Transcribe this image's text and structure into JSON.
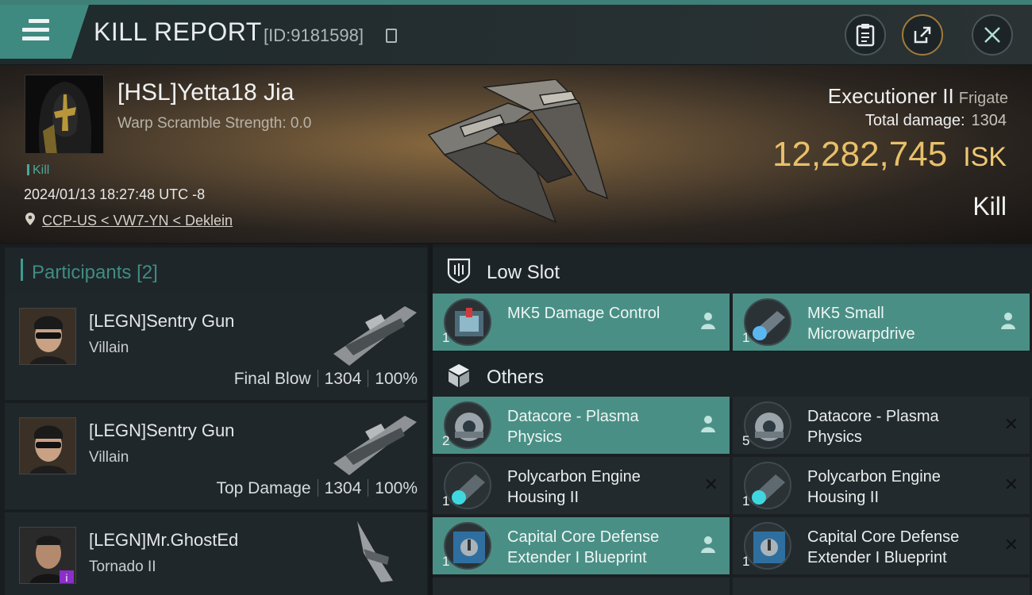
{
  "header": {
    "title": "KILL REPORT",
    "report_id": "[ID:9181598]"
  },
  "victim": {
    "name": "[HSL]Yetta18 Jia",
    "warp_scramble": "Warp Scramble Strength: 0.0",
    "tag": "Kill",
    "datetime": "2024/01/13 18:27:48 UTC -8",
    "location": "CCP-US < VW7-YN < Deklein",
    "ship": "Executioner II",
    "ship_class": "Frigate",
    "total_damage_label": "Total damage:",
    "total_damage": "1304",
    "isk_value": "12,282,745",
    "isk_unit": "ISK",
    "result": "Kill"
  },
  "participants": {
    "title": "Participants",
    "count": "[2]",
    "rows": [
      {
        "name": "[LEGN]Sentry Gun",
        "ship": "Villain",
        "role": "Final Blow",
        "damage": "1304",
        "percent": "100%"
      },
      {
        "name": "[LEGN]Sentry Gun",
        "ship": "Villain",
        "role": "Top Damage",
        "damage": "1304",
        "percent": "100%"
      },
      {
        "name": "[LEGN]Mr.GhostEd",
        "ship": "Tornado II"
      }
    ]
  },
  "sections": {
    "low_slot": "Low Slot",
    "others": "Others"
  },
  "items": [
    {
      "name": "MK5 Damage Control",
      "qty": "1",
      "status": "dropped"
    },
    {
      "name": "MK5 Small Microwarpdrive",
      "qty": "1",
      "status": "dropped"
    },
    {
      "name": "Datacore - Plasma Physics",
      "qty": "2",
      "status": "dropped"
    },
    {
      "name": "Datacore - Plasma Physics",
      "qty": "5",
      "status": "destroyed"
    },
    {
      "name": "Polycarbon Engine Housing II",
      "qty": "1",
      "status": "destroyed"
    },
    {
      "name": "Polycarbon Engine Housing II",
      "qty": "1",
      "status": "destroyed"
    },
    {
      "name": "Capital Core Defense Extender I Blueprint",
      "qty": "1",
      "status": "dropped"
    },
    {
      "name": "Capital Core Defense Extender I Blueprint",
      "qty": "1",
      "status": "destroyed"
    }
  ],
  "colors": {
    "accent": "#3f8a80",
    "isk": "#e8c06a"
  }
}
